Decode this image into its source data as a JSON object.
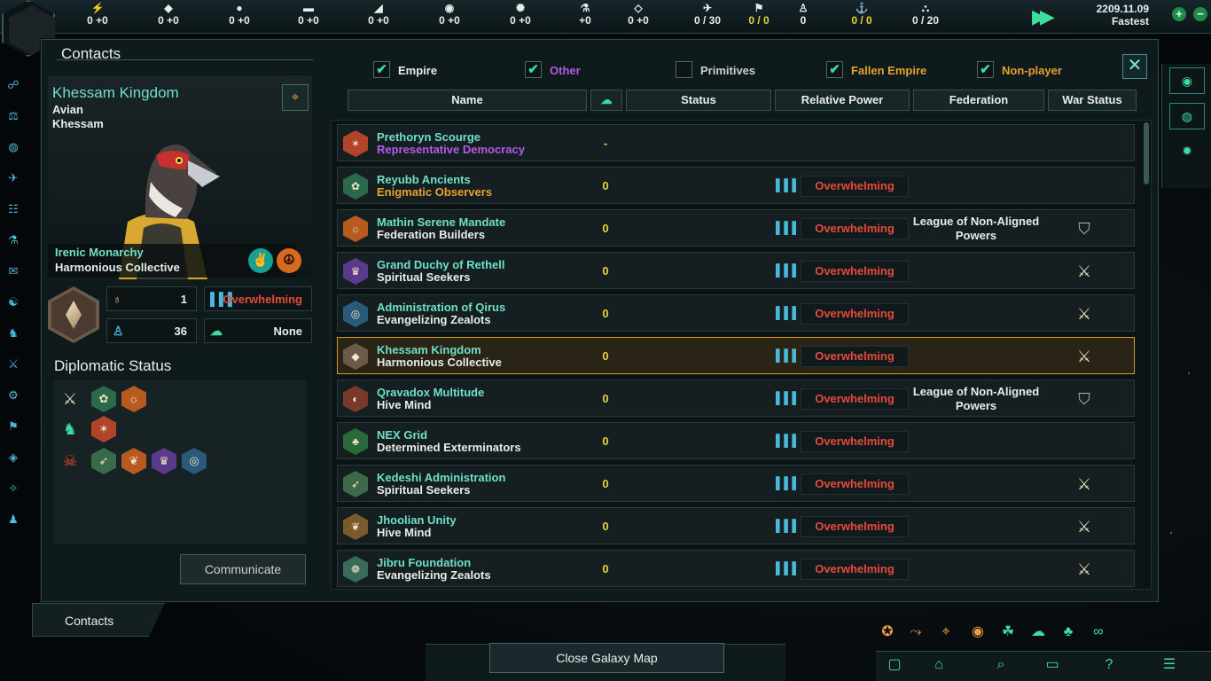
{
  "topbar": {
    "resources": [
      {
        "icon": "energy-icon",
        "glyph": "⚡",
        "value": "0 +0"
      },
      {
        "icon": "minerals-icon",
        "glyph": "◆",
        "value": "0 +0"
      },
      {
        "icon": "food-icon",
        "glyph": "●",
        "value": "0 +0"
      },
      {
        "icon": "alloys-icon",
        "glyph": "▬",
        "value": "0 +0"
      },
      {
        "icon": "consumer-goods-icon",
        "glyph": "◢",
        "value": "0 +0"
      },
      {
        "icon": "influence-icon",
        "glyph": "◉",
        "value": "0 +0"
      },
      {
        "icon": "unity-icon",
        "glyph": "✺",
        "value": "0 +0"
      },
      {
        "icon": "research-icon",
        "glyph": "⚗",
        "value": "+0"
      },
      {
        "icon": "amenities-icon",
        "glyph": "◇",
        "value": "0 +0"
      },
      {
        "icon": "fleet-icon",
        "glyph": "✈",
        "value": "0 / 30"
      },
      {
        "icon": "naval-cap-icon",
        "glyph": "⚑",
        "value": "0 / 0"
      },
      {
        "icon": "pops-icon",
        "glyph": "♙",
        "value": "0"
      },
      {
        "icon": "starbase-icon",
        "glyph": "⚓",
        "value": "0 / 0"
      },
      {
        "icon": "army-icon",
        "glyph": "⛬",
        "value": "0 / 20"
      }
    ],
    "date": "2209.11.09",
    "speed": "Fastest"
  },
  "window": {
    "title": "Contacts"
  },
  "empire": {
    "name": "Khessam Kingdom",
    "species": "Avian",
    "species_name": "Khessam",
    "government": "Irenic Monarchy",
    "civic": "Harmonious Collective",
    "planets": "1",
    "pops": "36",
    "relative_power": "Overwhelming",
    "opinion_label": "None"
  },
  "diplomatic": {
    "title": "Diplomatic Status",
    "communicate": "Communicate"
  },
  "filters": [
    {
      "label": "Empire",
      "checked": true,
      "color": "#e6ecea"
    },
    {
      "label": "Other",
      "checked": true,
      "color": "#b45ae6"
    },
    {
      "label": "Primitives",
      "checked": false,
      "color": "#c8d0d0"
    },
    {
      "label": "Fallen Empire",
      "checked": true,
      "color": "#e8a030"
    },
    {
      "label": "Non-player",
      "checked": true,
      "color": "#e8a030"
    }
  ],
  "headers": {
    "name": "Name",
    "status": "Status",
    "relative_power": "Relative Power",
    "federation": "Federation",
    "war_status": "War Status"
  },
  "rows": [
    {
      "name": "Prethoryn Scourge",
      "sub": "Representative Democracy",
      "sub_color": "#b45ae6",
      "opinion": "-",
      "power": "",
      "federation": "",
      "war": "",
      "color": "#b0452a",
      "glyph": "✶"
    },
    {
      "name": "Reyubb Ancients",
      "sub": "Enigmatic Observers",
      "sub_color": "#e8a030",
      "opinion": "0",
      "power": "Overwhelming",
      "federation": "",
      "war": "",
      "color": "#2a6a4a",
      "glyph": "✿"
    },
    {
      "name": "Mathin Serene Mandate",
      "sub": "Federation Builders",
      "sub_color": "#e6ecea",
      "opinion": "0",
      "power": "Overwhelming",
      "federation": "League of Non-Aligned Powers",
      "war": "shield",
      "color": "#b85a20",
      "glyph": "☼"
    },
    {
      "name": "Grand Duchy of Rethell",
      "sub": "Spiritual Seekers",
      "sub_color": "#e6ecea",
      "opinion": "0",
      "power": "Overwhelming",
      "federation": "",
      "war": "swords",
      "color": "#5a3a8a",
      "glyph": "♛"
    },
    {
      "name": "Administration of Qirus",
      "sub": "Evangelizing Zealots",
      "sub_color": "#e6ecea",
      "opinion": "0",
      "power": "Overwhelming",
      "federation": "",
      "war": "swords",
      "color": "#2a5a7a",
      "glyph": "◎"
    },
    {
      "name": "Khessam Kingdom",
      "sub": "Harmonious Collective",
      "sub_color": "#e6ecea",
      "opinion": "0",
      "power": "Overwhelming",
      "federation": "",
      "war": "swords",
      "color": "#6b5a48",
      "glyph": "◆",
      "selected": true
    },
    {
      "name": "Qravadox Multitude",
      "sub": "Hive Mind",
      "sub_color": "#e6ecea",
      "opinion": "0",
      "power": "Overwhelming",
      "federation": "League of Non-Aligned Powers",
      "war": "shield",
      "color": "#7a3a2a",
      "glyph": "◐"
    },
    {
      "name": "NEX Grid",
      "sub": "Determined Exterminators",
      "sub_color": "#e6ecea",
      "opinion": "0",
      "power": "Overwhelming",
      "federation": "",
      "war": "",
      "color": "#2a6a3a",
      "glyph": "♣"
    },
    {
      "name": "Kedeshi Administration",
      "sub": "Spiritual Seekers",
      "sub_color": "#e6ecea",
      "opinion": "0",
      "power": "Overwhelming",
      "federation": "",
      "war": "swords",
      "color": "#3a6a4a",
      "glyph": "➶"
    },
    {
      "name": "Jhoolian Unity",
      "sub": "Hive Mind",
      "sub_color": "#e6ecea",
      "opinion": "0",
      "power": "Overwhelming",
      "federation": "",
      "war": "swords",
      "color": "#7a5a2a",
      "glyph": "❦"
    },
    {
      "name": "Jibru Foundation",
      "sub": "Evangelizing Zealots",
      "sub_color": "#e6ecea",
      "opinion": "0",
      "power": "Overwhelming",
      "federation": "",
      "war": "swords",
      "color": "#3a6a5a",
      "glyph": "❁"
    }
  ],
  "bottom": {
    "contacts_tab": "Contacts",
    "close_galaxy_map": "Close Galaxy Map"
  }
}
